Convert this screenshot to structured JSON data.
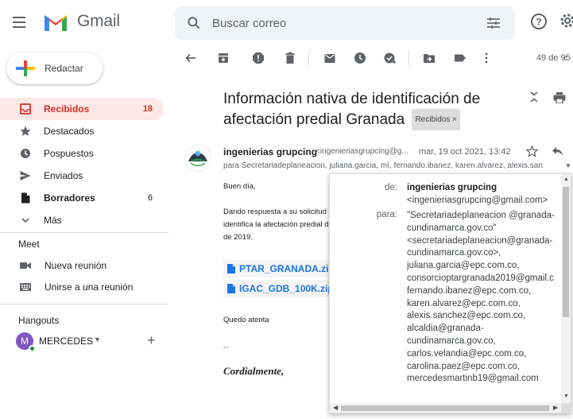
{
  "app": {
    "name": "Gmail"
  },
  "search": {
    "placeholder": "Buscar correo"
  },
  "compose": {
    "label": "Redactar"
  },
  "sidebar": {
    "items": [
      {
        "label": "Recibidos",
        "count": "18",
        "icon": "inbox-icon",
        "active": true
      },
      {
        "label": "Destacados",
        "count": "",
        "icon": "star-icon"
      },
      {
        "label": "Pospuestos",
        "count": "",
        "icon": "clock-icon"
      },
      {
        "label": "Enviados",
        "count": "",
        "icon": "send-icon"
      },
      {
        "label": "Borradores",
        "count": "6",
        "icon": "draft-icon",
        "bold": true
      },
      {
        "label": "Más",
        "count": "",
        "icon": "chevron-down-icon"
      }
    ]
  },
  "meet": {
    "title": "Meet",
    "new_meeting": "Nueva reunión",
    "join_meeting": "Unirse a una reunión"
  },
  "hangouts": {
    "title": "Hangouts",
    "user_initial": "M",
    "user_name": "MERCEDES"
  },
  "toolbar": {
    "pager": "49 de 95"
  },
  "message": {
    "subject": "Información nativa de identificación de afectación predial Granada",
    "label_chip": "Recibidos ×",
    "sender_name": "ingenierias grupcing",
    "sender_email": "<ingenieriasgrupcing@g...",
    "date": "mar, 19 oct 2021, 13:42",
    "to_line": "para Secretariadeplaneacion, juliana.garcia, mí, fernando.ibanez, karen.alvarez, alexis.san",
    "greeting": "Buen día,",
    "body_line1": "Dando respuesta a su solicitud se",
    "body_line2": "identifica la afectación predial del",
    "body_line3": "de 2019.",
    "attachments": [
      "PTAR_GRANADA.zip",
      "IGAC_GDB_100K.zip"
    ],
    "closing": "Quedo atenta",
    "separator": "--",
    "signoff": "Cordialmente,"
  },
  "details": {
    "from_label": "de:",
    "from_name": "ingenierias grupcing",
    "from_email": "<ingenieriasgrupcing@gmail.com>",
    "to_label": "para:",
    "to_list": "\"Secretariadeplaneacion @granada-\ncundinamarca.gov.co\"\n<secretariadeplaneacion@granada-\ncundinamarca.gov.co>,\njuliana.garcia@epc.com.co,\nconsorcioptargranada2019@gmail.c\nfernando.ibanez@epc.com.co,\nkaren.alvarez@epc.com.co,\nalexis.sanchez@epc.com.co,\nalcaldia@granada-\ncundinamarca.gov.co,\ncarlos.velandia@epc.com.co,\ncarolina.paez@epc.com.co,\nmercedesmartinb19@gmail.com"
  },
  "colors": {
    "accent_red": "#d93025",
    "active_bg": "#fce8e6",
    "link_blue": "#1a73e8"
  }
}
